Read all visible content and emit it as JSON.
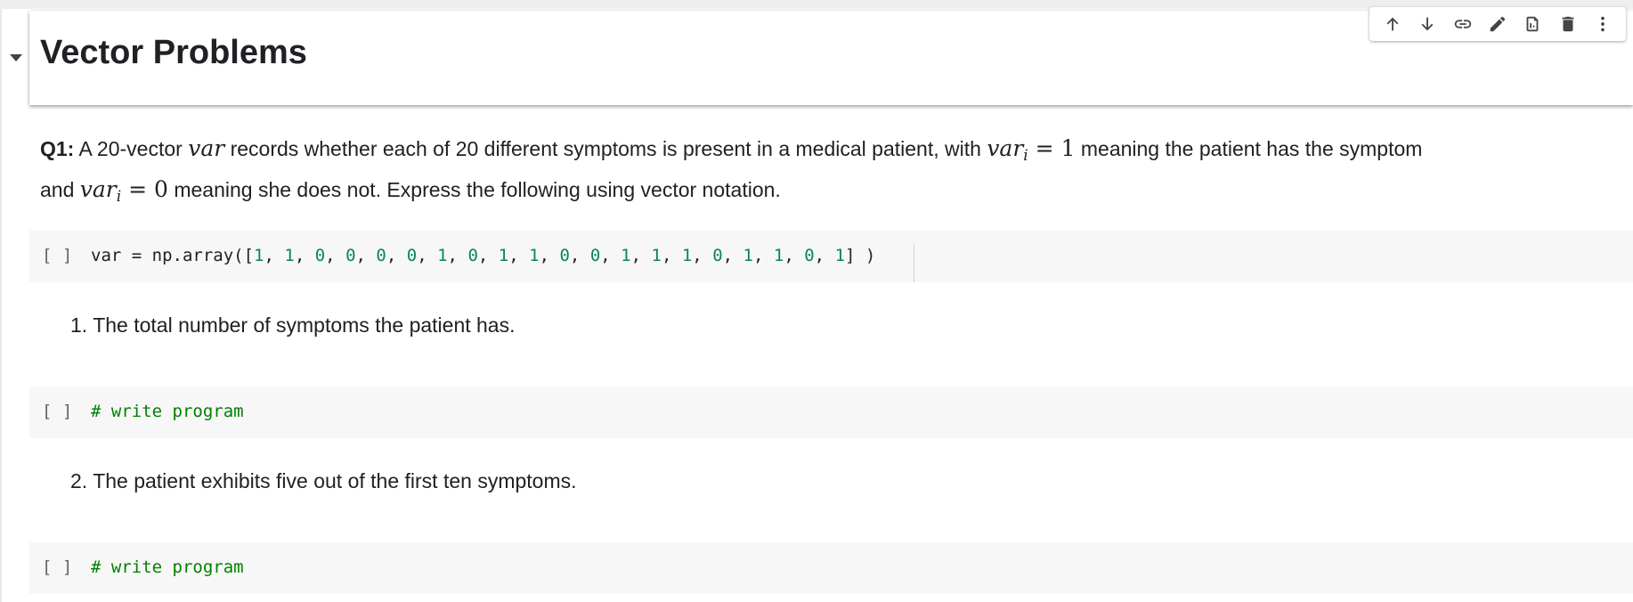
{
  "heading": {
    "title": "Vector Problems"
  },
  "toolbar": {
    "buttons": [
      {
        "name": "move-cell-up",
        "icon": "arrow-up-icon"
      },
      {
        "name": "move-cell-down",
        "icon": "arrow-down-icon"
      },
      {
        "name": "copy-link",
        "icon": "link-icon"
      },
      {
        "name": "edit-cell",
        "icon": "pencil-icon"
      },
      {
        "name": "mirror-cell",
        "icon": "mirror-icon"
      },
      {
        "name": "delete-cell",
        "icon": "trash-icon"
      },
      {
        "name": "more-actions",
        "icon": "more-vert-icon"
      }
    ]
  },
  "q1": {
    "label": "Q1:",
    "text_a": " A 20-vector ",
    "var": "var",
    "text_b": " records whether each of 20 different symptoms is present in a medical patient, with ",
    "var_i": "var",
    "sub_i": "i",
    "eq1": " = 1",
    "text_c": " meaning the patient has the symptom and ",
    "eq0": " = 0",
    "text_d": " meaning she does not. Express the following using vector notation."
  },
  "code_cells": [
    {
      "bracket": "[ ]",
      "prefix": "var = np.array([",
      "values": [
        "1",
        "1",
        "0",
        "0",
        "0",
        "0",
        "1",
        "0",
        "1",
        "1",
        "0",
        "0",
        "1",
        "1",
        "1",
        "0",
        "1",
        "1",
        "0",
        "1"
      ],
      "suffix": "] )"
    },
    {
      "bracket": "[ ]",
      "comment": "# write program"
    },
    {
      "bracket": "[ ]",
      "comment": "# write program"
    }
  ],
  "list_items": [
    {
      "number": "1.",
      "text": "The total number of symptoms the patient has."
    },
    {
      "number": "2.",
      "text": "The patient exhibits five out of the first ten symptoms."
    }
  ],
  "colors": {
    "number_token": "#098658",
    "comment": "#008000",
    "code_background": "#f7f7f7"
  }
}
